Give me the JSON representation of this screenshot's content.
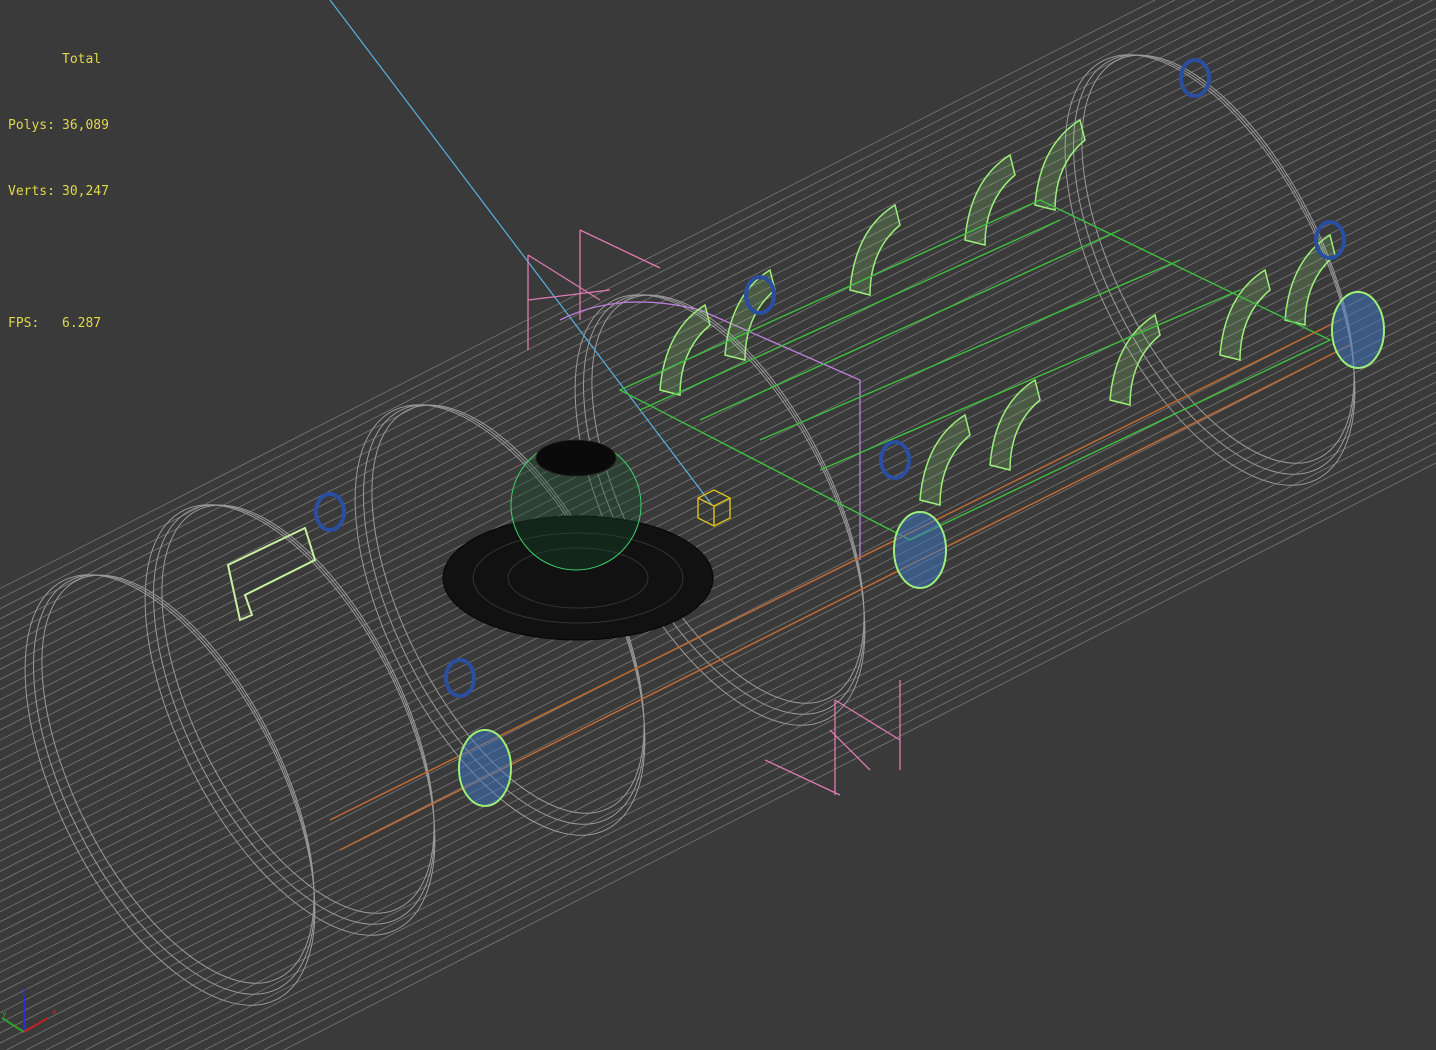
{
  "viewport": {
    "stats": {
      "header": "Total",
      "polys_label": "Polys:",
      "polys_value": "36,089",
      "verts_label": "Verts:",
      "verts_value": "30,247",
      "fps_label": "FPS:",
      "fps_value": "6.287"
    },
    "axis_gizmo": {
      "x": "x",
      "y": "y",
      "z": "z"
    },
    "colors": {
      "background": "#3a3a3a",
      "stats_text": "#e0d84a",
      "wire_gray": "#8a8a8a",
      "wire_green": "#9cf07a",
      "wire_pink": "#e07ab0",
      "wire_blue": "#2a4fa0",
      "wire_black": "#0a0a0a",
      "light_line": "#5ab0e0"
    }
  }
}
